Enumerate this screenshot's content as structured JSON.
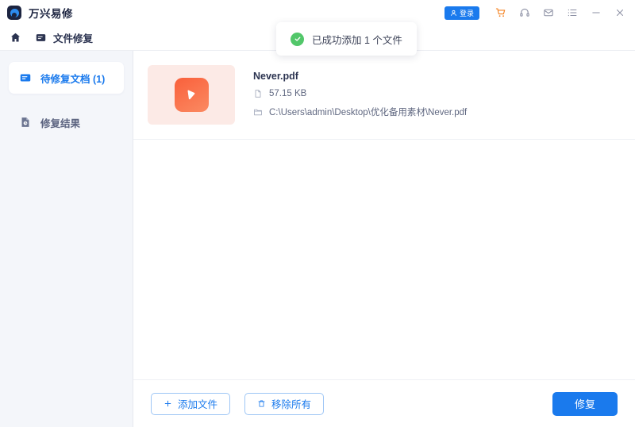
{
  "titlebar": {
    "brand_name": "万兴易修",
    "logo_icon": "app-logo-icon",
    "login_label": "登录",
    "icons": [
      {
        "name": "cart-icon",
        "color": "#f58220"
      },
      {
        "name": "headset-icon",
        "color": "#8b8fa3"
      },
      {
        "name": "mail-icon",
        "color": "#8b8fa3"
      },
      {
        "name": "list-menu-icon",
        "color": "#8b8fa3"
      },
      {
        "name": "minimize-icon",
        "color": "#8b8fa3"
      },
      {
        "name": "close-icon",
        "color": "#8b8fa3"
      }
    ]
  },
  "navbar": {
    "home_icon": "home-icon",
    "tab_icon": "document-repair-icon",
    "tab_label": "文件修复"
  },
  "toast": {
    "icon": "success-check-icon",
    "message": "已成功添加 1 个文件",
    "accent": "#52c76a"
  },
  "sidebar": {
    "items": [
      {
        "label": "待修复文档 (1)",
        "icon": "pending-document-icon",
        "active": true
      },
      {
        "label": "修复结果",
        "icon": "repair-result-icon",
        "active": false
      }
    ]
  },
  "main": {
    "files": [
      {
        "name": "Never.pdf",
        "size": "57.15  KB",
        "path": "C:\\Users\\admin\\Desktop\\优化备用素材\\Never.pdf",
        "thumb_icon": "pdf-play-thumbnail-icon",
        "size_icon": "file-icon",
        "path_icon": "folder-icon"
      }
    ]
  },
  "footer": {
    "add_file_label": "添加文件",
    "add_file_icon": "plus-icon",
    "remove_all_label": "移除所有",
    "remove_all_icon": "trash-icon",
    "repair_label": "修复",
    "primary_color": "#1a7aed"
  }
}
